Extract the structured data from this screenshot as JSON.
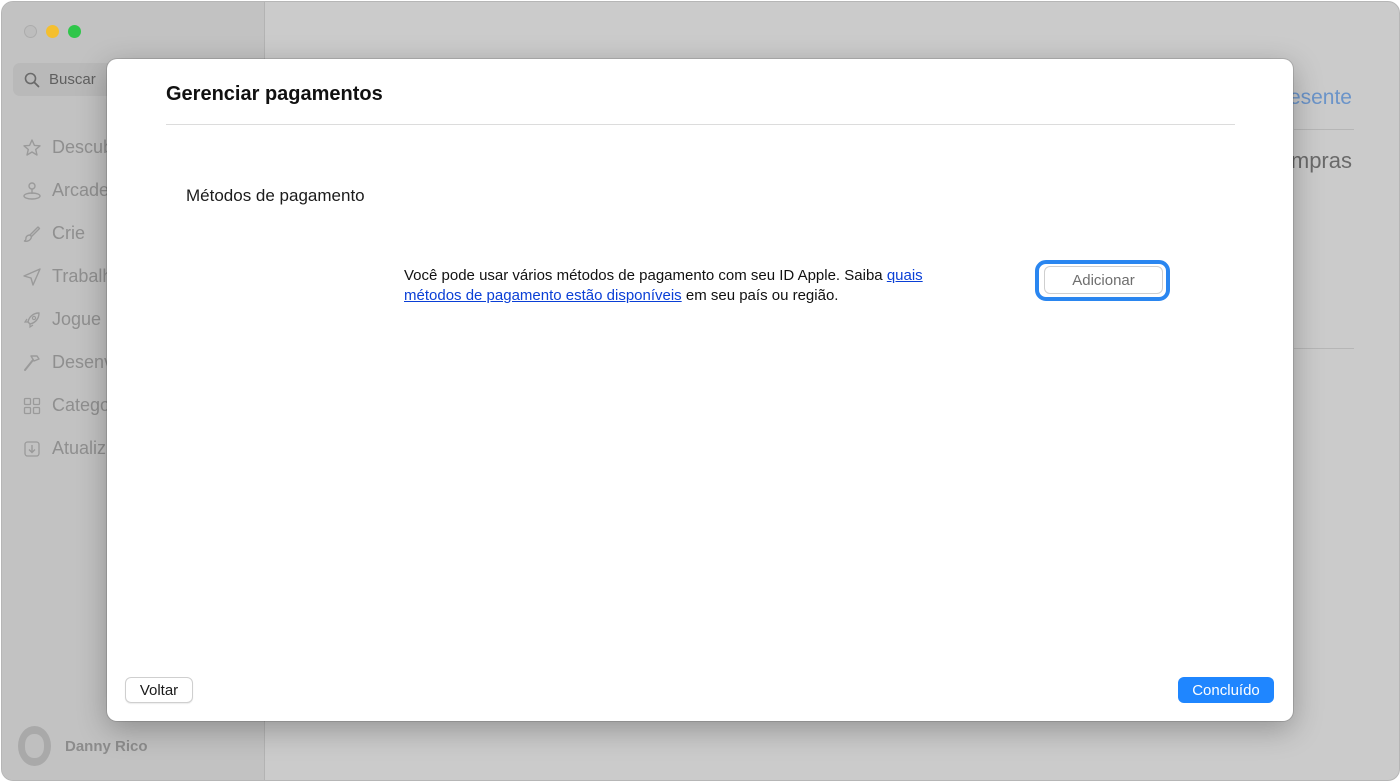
{
  "window": {
    "controls": [
      "close",
      "minimize",
      "zoom"
    ]
  },
  "sidebar": {
    "search": {
      "label": "Buscar",
      "icon": "search-icon"
    },
    "items": [
      {
        "label": "Descub",
        "icon": "star-icon"
      },
      {
        "label": "Arcade",
        "icon": "joystick-icon"
      },
      {
        "label": "Crie",
        "icon": "brush-icon"
      },
      {
        "label": "Trabalh",
        "icon": "paper-plane-icon"
      },
      {
        "label": "Jogue",
        "icon": "rocket-icon"
      },
      {
        "label": "Desenv",
        "icon": "hammer-icon"
      },
      {
        "label": "Catego",
        "icon": "grid-icon"
      },
      {
        "label": "Atualiz",
        "icon": "download-icon"
      }
    ],
    "user": {
      "name": "Danny Rico"
    }
  },
  "background": {
    "link_fragment": "esente",
    "title_fragment": "mpras"
  },
  "sheet": {
    "title": "Gerenciar pagamentos",
    "section_label": "Métodos de pagamento",
    "info": {
      "text_before": "Você pode usar vários métodos de pagamento com seu ID Apple. Saiba ",
      "link": "quais métodos de pagamento estão disponíveis",
      "text_after": " em seu país ou região."
    },
    "add_button": "Adicionar",
    "back_button": "Voltar",
    "done_button": "Concluído"
  },
  "colors": {
    "accent": "#1f86ff",
    "focus_ring": "#2a86f0",
    "link": "#0a3fd6"
  }
}
